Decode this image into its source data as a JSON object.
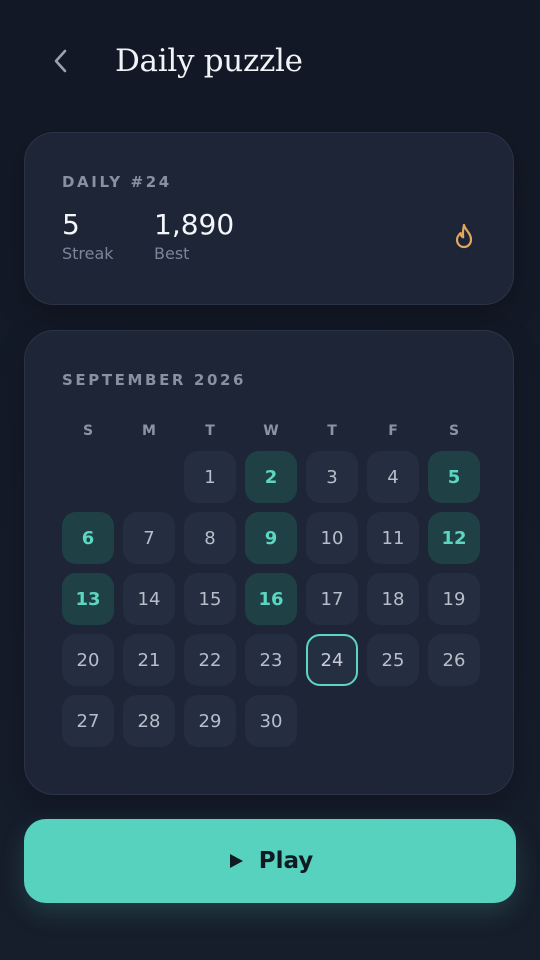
{
  "header": {
    "back_icon": "chevron-left-icon",
    "title": "Daily puzzle"
  },
  "stats": {
    "daily_label": "DAILY #24",
    "streak_value": "5",
    "streak_label": "Streak",
    "best_value": "1,890",
    "best_label": "Best",
    "flame_icon": "flame-icon",
    "flame_color": "#e0a75e"
  },
  "calendar": {
    "month_label": "SEPTEMBER 2026",
    "weekdays": [
      "S",
      "M",
      "T",
      "W",
      "T",
      "F",
      "S"
    ],
    "first_weekday_index": 2,
    "days": [
      "1",
      "2",
      "3",
      "4",
      "5",
      "6",
      "7",
      "8",
      "9",
      "10",
      "11",
      "12",
      "13",
      "14",
      "15",
      "16",
      "17",
      "18",
      "19",
      "20",
      "21",
      "22",
      "23",
      "24",
      "25",
      "26",
      "27",
      "28",
      "29",
      "30"
    ],
    "completed_days": [
      "2",
      "5",
      "6",
      "9",
      "12",
      "13",
      "16"
    ],
    "today": "24",
    "accent_color": "#5dd6c1"
  },
  "play": {
    "icon": "play-icon",
    "label": "Play",
    "color": "#56d2bf"
  }
}
